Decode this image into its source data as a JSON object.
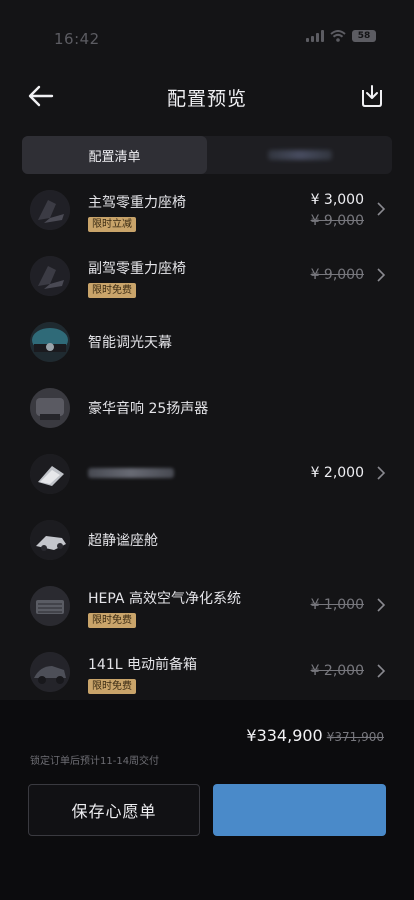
{
  "status": {
    "time": "16:42",
    "battery": "58"
  },
  "header": {
    "title": "配置预览"
  },
  "tabs": [
    {
      "label": "配置清单"
    }
  ],
  "items": [
    {
      "name": "主驾零重力座椅",
      "badge": "限时立减",
      "price": "¥ 3,000",
      "original": "¥ 9,000"
    },
    {
      "name": "副驾零重力座椅",
      "badge": "限时免费",
      "original": "¥ 9,000"
    },
    {
      "name": "智能调光天幕"
    },
    {
      "name": "豪华音响 25扬声器"
    },
    {
      "price": "¥ 2,000"
    },
    {
      "name": "超静谧座舱"
    },
    {
      "name": "HEPA 高效空气净化系统",
      "badge": "限时免费",
      "original": "¥ 1,000"
    },
    {
      "name": "141L 电动前备箱",
      "badge": "限时免费",
      "original": "¥ 2,000"
    }
  ],
  "summary": {
    "total": "¥334,900",
    "original_total": "¥371,900",
    "delivery": "锁定订单后预计11-14周交付"
  },
  "buttons": {
    "save": "保存心愿单"
  },
  "colors": {
    "accent": "#4a8ac9",
    "badge": "#c9a46a",
    "background": "#141416"
  },
  "icons": {
    "back": "arrow-left-icon",
    "download": "download-icon",
    "chevron": "chevron-right-icon"
  }
}
